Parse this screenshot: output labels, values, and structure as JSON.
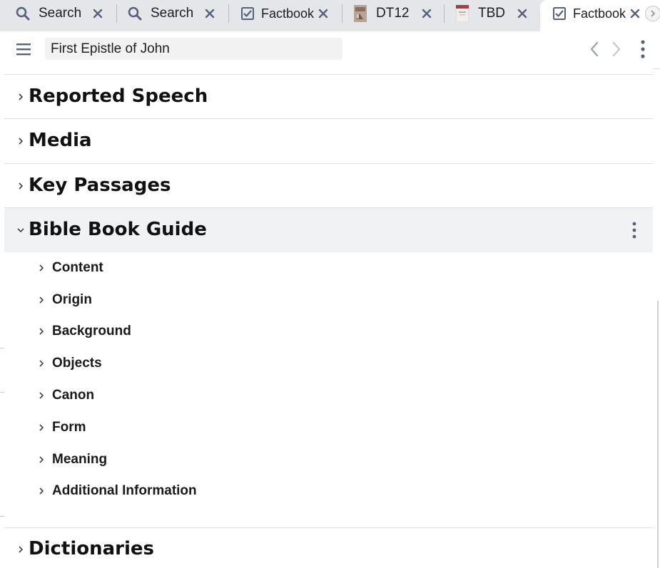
{
  "tabs": [
    {
      "label": "Search",
      "icon": "search-icon"
    },
    {
      "label": "Search",
      "icon": "search-icon"
    },
    {
      "label": "Factbook",
      "icon": "factbook-icon"
    },
    {
      "label": "DT12",
      "icon": "book-cover-icon"
    },
    {
      "label": "TBD",
      "icon": "book-cover-icon"
    },
    {
      "label": "Factbook",
      "icon": "factbook-icon",
      "active": true
    }
  ],
  "toolbar": {
    "search_value": "First Epistle of John"
  },
  "sections": [
    {
      "title": "Reported Speech",
      "expanded": false
    },
    {
      "title": "Media",
      "expanded": false
    },
    {
      "title": "Key Passages",
      "expanded": false
    },
    {
      "title": "Bible Book Guide",
      "expanded": true
    },
    {
      "title": "Dictionaries",
      "expanded": false
    }
  ],
  "bible_book_guide_items": [
    "Content",
    "Origin",
    "Background",
    "Objects",
    "Canon",
    "Form",
    "Meaning",
    "Additional Information"
  ],
  "colors": {
    "tabbar_bg": "#e4e6ea",
    "icon_slate": "#56617a",
    "expanded_bg": "#f1f2f3",
    "text": "#111111"
  }
}
